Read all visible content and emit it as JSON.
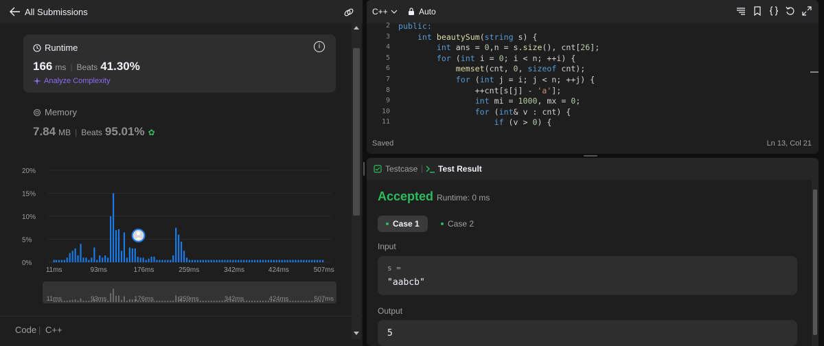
{
  "left_panel": {
    "back_label": "All Submissions",
    "runtime": {
      "title": "Runtime",
      "value": "166",
      "unit": "ms",
      "beats_label": "Beats",
      "beats_value": "41.30%",
      "analyze_label": "Analyze Complexity"
    },
    "memory": {
      "title": "Memory",
      "value": "7.84",
      "unit": "MB",
      "beats_label": "Beats",
      "beats_value": "95.01%"
    },
    "footer": {
      "code_label": "Code",
      "separator": "|",
      "language": "C++"
    }
  },
  "chart_data": {
    "type": "bar",
    "title": "",
    "xlabel": "",
    "ylabel": "",
    "y_ticks": [
      "20%",
      "15%",
      "10%",
      "5%",
      "0%"
    ],
    "ylim": [
      0,
      20
    ],
    "x_tick_labels": [
      "11ms",
      "93ms",
      "176ms",
      "259ms",
      "342ms",
      "424ms",
      "507ms"
    ],
    "xlim_ms": [
      0,
      520
    ],
    "grid": true,
    "highlight_ms": 166,
    "bars": [
      {
        "ms": 11,
        "value": 0.5
      },
      {
        "ms": 15,
        "value": 0.5
      },
      {
        "ms": 20,
        "value": 0.5
      },
      {
        "ms": 25,
        "value": 0.5
      },
      {
        "ms": 30,
        "value": 0.5
      },
      {
        "ms": 35,
        "value": 1.0
      },
      {
        "ms": 40,
        "value": 2.0
      },
      {
        "ms": 45,
        "value": 2.5
      },
      {
        "ms": 50,
        "value": 3.0
      },
      {
        "ms": 55,
        "value": 1.5
      },
      {
        "ms": 60,
        "value": 4.0
      },
      {
        "ms": 65,
        "value": 1.0
      },
      {
        "ms": 70,
        "value": 1.0
      },
      {
        "ms": 75,
        "value": 0.5
      },
      {
        "ms": 80,
        "value": 1.0
      },
      {
        "ms": 85,
        "value": 3.2
      },
      {
        "ms": 90,
        "value": 0.5
      },
      {
        "ms": 95,
        "value": 1.5
      },
      {
        "ms": 100,
        "value": 1.0
      },
      {
        "ms": 105,
        "value": 1.5
      },
      {
        "ms": 110,
        "value": 1.0
      },
      {
        "ms": 115,
        "value": 10.0
      },
      {
        "ms": 120,
        "value": 15.0
      },
      {
        "ms": 125,
        "value": 7.0
      },
      {
        "ms": 130,
        "value": 7.2
      },
      {
        "ms": 135,
        "value": 2.5
      },
      {
        "ms": 140,
        "value": 6.5
      },
      {
        "ms": 145,
        "value": 1.0
      },
      {
        "ms": 150,
        "value": 3.2
      },
      {
        "ms": 155,
        "value": 3.0
      },
      {
        "ms": 160,
        "value": 3.0
      },
      {
        "ms": 165,
        "value": 1.2
      },
      {
        "ms": 170,
        "value": 1.0
      },
      {
        "ms": 175,
        "value": 1.0
      },
      {
        "ms": 180,
        "value": 0.5
      },
      {
        "ms": 185,
        "value": 0.8
      },
      {
        "ms": 190,
        "value": 1.2
      },
      {
        "ms": 195,
        "value": 1.2
      },
      {
        "ms": 200,
        "value": 0.5
      },
      {
        "ms": 205,
        "value": 0.5
      },
      {
        "ms": 210,
        "value": 0.5
      },
      {
        "ms": 215,
        "value": 0.5
      },
      {
        "ms": 220,
        "value": 0.5
      },
      {
        "ms": 225,
        "value": 0.5
      },
      {
        "ms": 230,
        "value": 1.5
      },
      {
        "ms": 235,
        "value": 7.5
      },
      {
        "ms": 240,
        "value": 6.0
      },
      {
        "ms": 245,
        "value": 4.5
      },
      {
        "ms": 250,
        "value": 2.5
      },
      {
        "ms": 255,
        "value": 1.0
      },
      {
        "ms": 260,
        "value": 0.5
      },
      {
        "ms": 265,
        "value": 0.5
      },
      {
        "ms": 270,
        "value": 0.5
      },
      {
        "ms": 275,
        "value": 0.5
      },
      {
        "ms": 280,
        "value": 0.5
      },
      {
        "ms": 285,
        "value": 0.5
      },
      {
        "ms": 290,
        "value": 0.5
      },
      {
        "ms": 295,
        "value": 0.5
      },
      {
        "ms": 300,
        "value": 0.5
      },
      {
        "ms": 305,
        "value": 0.5
      },
      {
        "ms": 310,
        "value": 0.5
      },
      {
        "ms": 315,
        "value": 0.5
      },
      {
        "ms": 320,
        "value": 0.5
      },
      {
        "ms": 325,
        "value": 0.5
      },
      {
        "ms": 330,
        "value": 0.5
      },
      {
        "ms": 335,
        "value": 0.5
      },
      {
        "ms": 340,
        "value": 0.5
      },
      {
        "ms": 345,
        "value": 0.5
      },
      {
        "ms": 350,
        "value": 0.5
      },
      {
        "ms": 355,
        "value": 0.5
      },
      {
        "ms": 360,
        "value": 0.5
      },
      {
        "ms": 365,
        "value": 0.5
      },
      {
        "ms": 370,
        "value": 0.5
      },
      {
        "ms": 375,
        "value": 0.5
      },
      {
        "ms": 380,
        "value": 0.5
      },
      {
        "ms": 385,
        "value": 0.5
      },
      {
        "ms": 390,
        "value": 0.5
      },
      {
        "ms": 395,
        "value": 0.5
      },
      {
        "ms": 400,
        "value": 0.5
      },
      {
        "ms": 405,
        "value": 0.5
      },
      {
        "ms": 410,
        "value": 0.5
      },
      {
        "ms": 415,
        "value": 0.5
      },
      {
        "ms": 420,
        "value": 0.5
      },
      {
        "ms": 425,
        "value": 0.5
      },
      {
        "ms": 430,
        "value": 0.5
      },
      {
        "ms": 435,
        "value": 0.5
      },
      {
        "ms": 440,
        "value": 0.5
      },
      {
        "ms": 445,
        "value": 0.5
      },
      {
        "ms": 450,
        "value": 0.5
      },
      {
        "ms": 455,
        "value": 0.5
      },
      {
        "ms": 460,
        "value": 0.5
      },
      {
        "ms": 465,
        "value": 0.5
      },
      {
        "ms": 470,
        "value": 0.5
      },
      {
        "ms": 475,
        "value": 0.5
      },
      {
        "ms": 480,
        "value": 0.5
      },
      {
        "ms": 485,
        "value": 0.5
      },
      {
        "ms": 490,
        "value": 0.5
      },
      {
        "ms": 495,
        "value": 0.5
      },
      {
        "ms": 500,
        "value": 0.5
      },
      {
        "ms": 505,
        "value": 0.5
      }
    ]
  },
  "editor": {
    "language": "C++",
    "mode": "Auto",
    "status_saved": "Saved",
    "cursor": "Ln 13, Col 21",
    "lines": [
      {
        "n": "2",
        "text": "public:"
      },
      {
        "n": "3",
        "text": "    int beautySum(string s) {"
      },
      {
        "n": "4",
        "text": "        int ans = 0,n = s.size(), cnt[26];"
      },
      {
        "n": "5",
        "text": "        for (int i = 0; i < n; ++i) {"
      },
      {
        "n": "6",
        "text": "            memset(cnt, 0, sizeof cnt);"
      },
      {
        "n": "7",
        "text": "            for (int j = i; j < n; ++j) {"
      },
      {
        "n": "8",
        "text": "                ++cnt[s[j] - 'a'];"
      },
      {
        "n": "9",
        "text": "                int mi = 1000, mx = 0;"
      },
      {
        "n": "10",
        "text": "                for (int& v : cnt) {"
      },
      {
        "n": "11",
        "text": "                    if (v > 0) {"
      }
    ]
  },
  "test_panel": {
    "tab_testcase": "Testcase",
    "tab_separator": "|",
    "tab_result": "Test Result",
    "status": "Accepted",
    "runtime": "Runtime: 0 ms",
    "case_1": "Case 1",
    "case_2": "Case 2",
    "input_label": "Input",
    "input_var": "s =",
    "input_value": "\"aabcb\"",
    "output_label": "Output",
    "output_value": "5"
  },
  "colors": {
    "accent_green": "#2cbb5d",
    "bar_blue": "#1a7ae8",
    "analyze_purple": "#8a6df2"
  }
}
